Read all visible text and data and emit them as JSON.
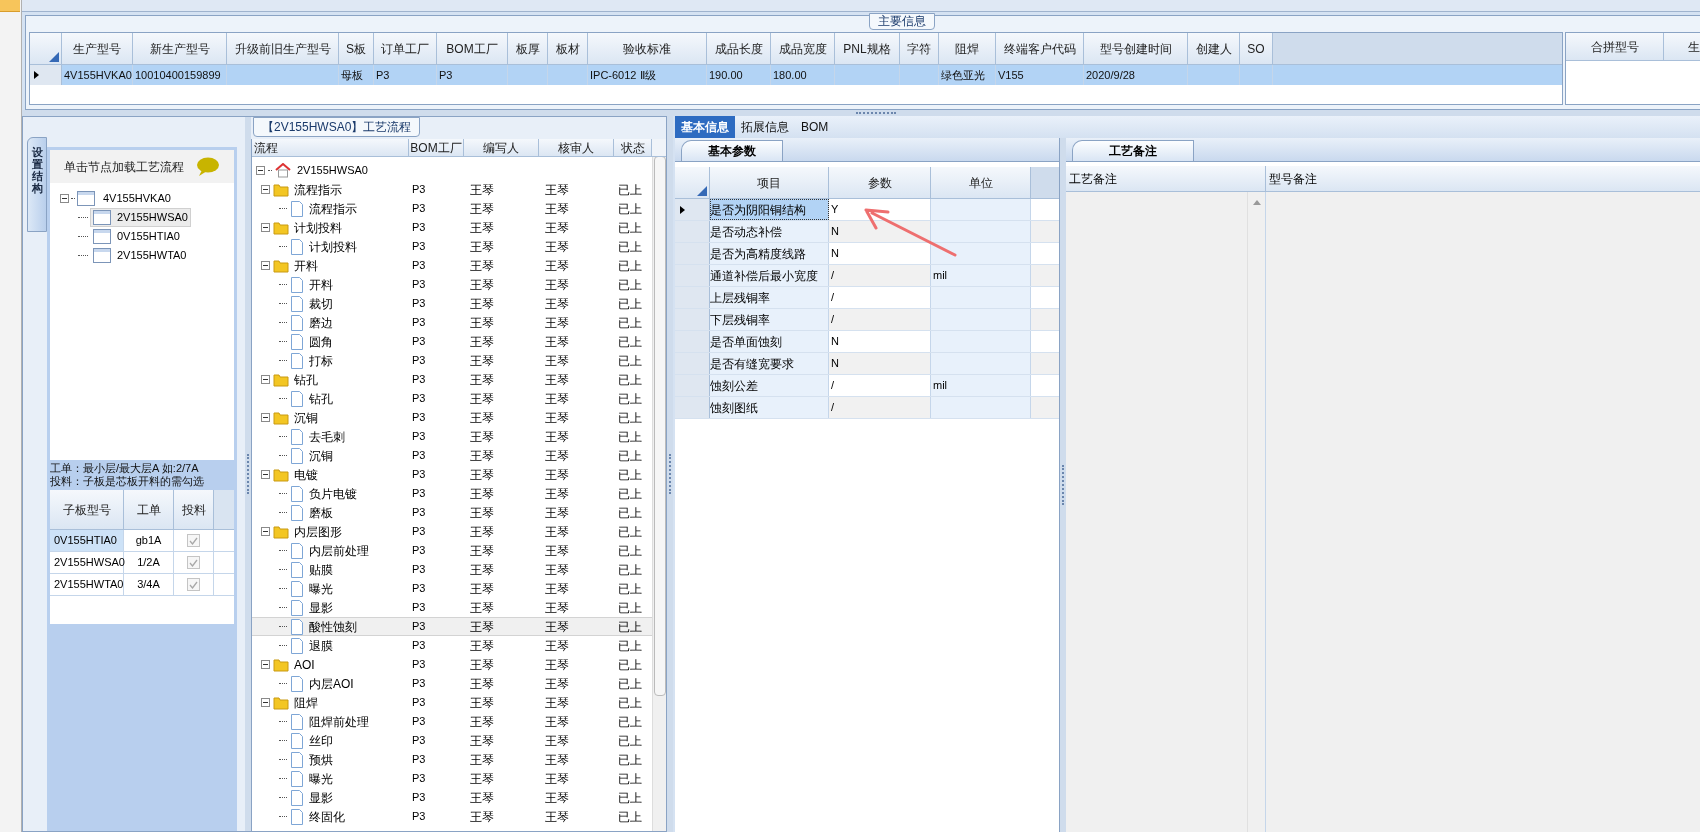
{
  "main_info": {
    "title": "主要信息",
    "columns": [
      "生产型号",
      "新生产型号",
      "升级前旧生产型号",
      "S板",
      "订单工厂",
      "BOM工厂",
      "板厚",
      "板材",
      "验收标准",
      "成品长度",
      "成品宽度",
      "PNL规格",
      "字符",
      "阻焊",
      "终端客户代码",
      "型号创建时间",
      "创建人",
      "SO"
    ],
    "rows": [
      {
        "selected": true,
        "cells": [
          "4V155HVKA0",
          "10010400159899",
          "",
          "母板",
          "P3",
          "P3",
          "",
          "",
          "IPC-6012 Ⅱ级",
          "190.00",
          "180.00",
          "",
          "",
          "绿色亚光",
          "V155",
          "2020/9/28",
          "",
          ""
        ]
      }
    ],
    "merge_columns": [
      "合拼型号",
      "生"
    ]
  },
  "board_structure": {
    "side_tab": "设置结构",
    "title": "单击节点加载工艺流程",
    "tree": {
      "label": "4V155HVKA0",
      "expanded": true,
      "selected": false,
      "children": [
        {
          "label": "2V155HWSA0",
          "selected": true
        },
        {
          "label": "0V155HTIA0",
          "selected": false
        },
        {
          "label": "2V155HWTA0",
          "selected": false
        }
      ]
    },
    "notes": [
      "工单：最小层/最大层A 如:2/7A",
      "投料：子板是芯板开料的需勾选"
    ],
    "columns": [
      "子板型号",
      "工单",
      "投料"
    ],
    "rows": [
      {
        "board": "0V155HTIA0",
        "order": "gb1A",
        "feed": true,
        "selected": true
      },
      {
        "board": "2V155HWSA0",
        "order": "1/2A",
        "feed": true,
        "selected": false
      },
      {
        "board": "2V155HWTA0",
        "order": "3/4A",
        "feed": true,
        "selected": false
      }
    ]
  },
  "process": {
    "title": "【2V155HWSA0】工艺流程",
    "columns": [
      "流程",
      "BOM工厂",
      "编写人",
      "核审人",
      "状态"
    ],
    "root": {
      "label": "2V155HWSA0",
      "expanded": true,
      "children": [
        {
          "label": "流程指示",
          "bom": "P3",
          "writer": "王琴",
          "reviewer": "王琴",
          "status": "已上",
          "expanded": true,
          "selected": false,
          "children": [
            {
              "label": "流程指示",
              "bom": "P3",
              "writer": "王琴",
              "reviewer": "王琴",
              "status": "已上",
              "selected": false
            }
          ]
        },
        {
          "label": "计划投料",
          "bom": "P3",
          "writer": "王琴",
          "reviewer": "王琴",
          "status": "已上",
          "expanded": true,
          "selected": false,
          "children": [
            {
              "label": "计划投料",
              "bom": "P3",
              "writer": "王琴",
              "reviewer": "王琴",
              "status": "已上",
              "selected": false
            }
          ]
        },
        {
          "label": "开料",
          "bom": "P3",
          "writer": "王琴",
          "reviewer": "王琴",
          "status": "已上",
          "expanded": true,
          "selected": false,
          "children": [
            {
              "label": "开料",
              "bom": "P3",
              "writer": "王琴",
              "reviewer": "王琴",
              "status": "已上",
              "selected": false
            },
            {
              "label": "裁切",
              "bom": "P3",
              "writer": "王琴",
              "reviewer": "王琴",
              "status": "已上",
              "selected": false
            },
            {
              "label": "磨边",
              "bom": "P3",
              "writer": "王琴",
              "reviewer": "王琴",
              "status": "已上",
              "selected": false
            },
            {
              "label": "圆角",
              "bom": "P3",
              "writer": "王琴",
              "reviewer": "王琴",
              "status": "已上",
              "selected": false
            },
            {
              "label": "打标",
              "bom": "P3",
              "writer": "王琴",
              "reviewer": "王琴",
              "status": "已上",
              "selected": false
            }
          ]
        },
        {
          "label": "钻孔",
          "bom": "P3",
          "writer": "王琴",
          "reviewer": "王琴",
          "status": "已上",
          "expanded": true,
          "selected": false,
          "children": [
            {
              "label": "钻孔",
              "bom": "P3",
              "writer": "王琴",
              "reviewer": "王琴",
              "status": "已上",
              "selected": false
            }
          ]
        },
        {
          "label": "沉铜",
          "bom": "P3",
          "writer": "王琴",
          "reviewer": "王琴",
          "status": "已上",
          "expanded": true,
          "selected": false,
          "children": [
            {
              "label": "去毛刺",
              "bom": "P3",
              "writer": "王琴",
              "reviewer": "王琴",
              "status": "已上",
              "selected": false
            },
            {
              "label": "沉铜",
              "bom": "P3",
              "writer": "王琴",
              "reviewer": "王琴",
              "status": "已上",
              "selected": false
            }
          ]
        },
        {
          "label": "电镀",
          "bom": "P3",
          "writer": "王琴",
          "reviewer": "王琴",
          "status": "已上",
          "expanded": true,
          "selected": false,
          "children": [
            {
              "label": "负片电镀",
              "bom": "P3",
              "writer": "王琴",
              "reviewer": "王琴",
              "status": "已上",
              "selected": false
            },
            {
              "label": "磨板",
              "bom": "P3",
              "writer": "王琴",
              "reviewer": "王琴",
              "status": "已上",
              "selected": false
            }
          ]
        },
        {
          "label": "内层图形",
          "bom": "P3",
          "writer": "王琴",
          "reviewer": "王琴",
          "status": "已上",
          "expanded": true,
          "selected": false,
          "children": [
            {
              "label": "内层前处理",
              "bom": "P3",
              "writer": "王琴",
              "reviewer": "王琴",
              "status": "已上",
              "selected": false
            },
            {
              "label": "贴膜",
              "bom": "P3",
              "writer": "王琴",
              "reviewer": "王琴",
              "status": "已上",
              "selected": false
            },
            {
              "label": "曝光",
              "bom": "P3",
              "writer": "王琴",
              "reviewer": "王琴",
              "status": "已上",
              "selected": false
            },
            {
              "label": "显影",
              "bom": "P3",
              "writer": "王琴",
              "reviewer": "王琴",
              "status": "已上",
              "selected": false
            },
            {
              "label": "酸性蚀刻",
              "bom": "P3",
              "writer": "王琴",
              "reviewer": "王琴",
              "status": "已上",
              "selected": true
            },
            {
              "label": "退膜",
              "bom": "P3",
              "writer": "王琴",
              "reviewer": "王琴",
              "status": "已上",
              "selected": false
            }
          ]
        },
        {
          "label": "AOI",
          "bom": "P3",
          "writer": "王琴",
          "reviewer": "王琴",
          "status": "已上",
          "expanded": true,
          "selected": false,
          "children": [
            {
              "label": "内层AOI",
              "bom": "P3",
              "writer": "王琴",
              "reviewer": "王琴",
              "status": "已上",
              "selected": false
            }
          ]
        },
        {
          "label": "阻焊",
          "bom": "P3",
          "writer": "王琴",
          "reviewer": "王琴",
          "status": "已上",
          "expanded": true,
          "selected": false,
          "children": [
            {
              "label": "阻焊前处理",
              "bom": "P3",
              "writer": "王琴",
              "reviewer": "王琴",
              "status": "已上",
              "selected": false
            },
            {
              "label": "丝印",
              "bom": "P3",
              "writer": "王琴",
              "reviewer": "王琴",
              "status": "已上",
              "selected": false
            },
            {
              "label": "预烘",
              "bom": "P3",
              "writer": "王琴",
              "reviewer": "王琴",
              "status": "已上",
              "selected": false
            },
            {
              "label": "曝光",
              "bom": "P3",
              "writer": "王琴",
              "reviewer": "王琴",
              "status": "已上",
              "selected": false
            },
            {
              "label": "显影",
              "bom": "P3",
              "writer": "王琴",
              "reviewer": "王琴",
              "status": "已上",
              "selected": false
            },
            {
              "label": "终固化",
              "bom": "P3",
              "writer": "王琴",
              "reviewer": "王琴",
              "status": "已上",
              "selected": false
            }
          ]
        }
      ]
    }
  },
  "detail_tabs": [
    {
      "label": "基本信息",
      "selected": true
    },
    {
      "label": "拓展信息",
      "selected": false
    },
    {
      "label": "BOM",
      "selected": false
    }
  ],
  "params": {
    "tab": "基本参数",
    "columns": [
      "项目",
      "参数",
      "单位"
    ],
    "rows": [
      {
        "item": "是否为阴阳铜结构",
        "value": "Y",
        "unit": "",
        "selected": true
      },
      {
        "item": "是否动态补偿",
        "value": "N",
        "unit": "",
        "selected": false
      },
      {
        "item": "是否为高精度线路",
        "value": "N",
        "unit": "",
        "selected": false
      },
      {
        "item": "通道补偿后最小宽度",
        "value": "/",
        "unit": "mil",
        "selected": false
      },
      {
        "item": "上层残铜率",
        "value": "/",
        "unit": "",
        "selected": false
      },
      {
        "item": "下层残铜率",
        "value": "/",
        "unit": "",
        "selected": false
      },
      {
        "item": "是否单面蚀刻",
        "value": "N",
        "unit": "",
        "selected": false
      },
      {
        "item": "是否有缝宽要求",
        "value": "N",
        "unit": "",
        "selected": false
      },
      {
        "item": "蚀刻公差",
        "value": "/",
        "unit": "mil",
        "selected": false
      },
      {
        "item": "蚀刻图纸",
        "value": "/",
        "unit": "",
        "selected": false
      }
    ]
  },
  "notes_panel": {
    "tab": "工艺备注",
    "columns": [
      "工艺备注",
      "型号备注"
    ]
  }
}
